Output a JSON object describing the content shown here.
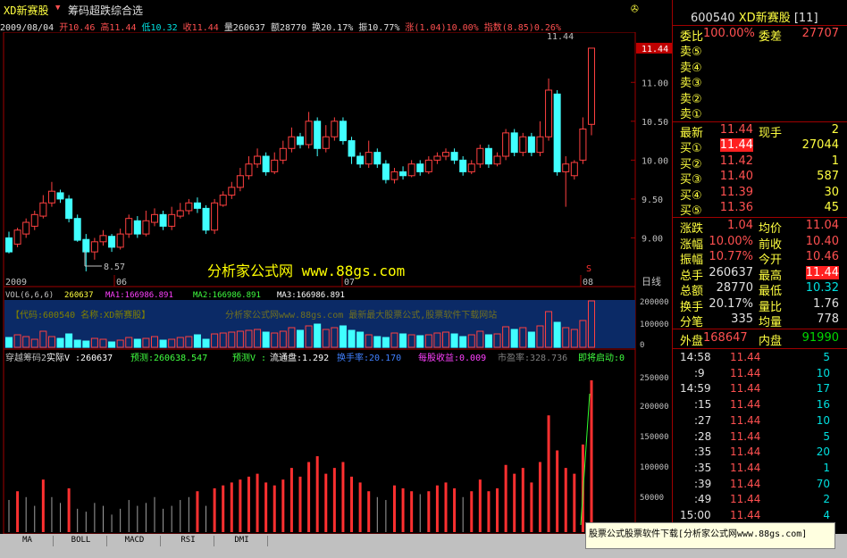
{
  "header": {
    "stock_name": "XD新赛股",
    "indicator_name": "筹码超跌综合选",
    "arrow_glyph": "▼"
  },
  "info": {
    "date": "2009/08/04",
    "open": "开10.46",
    "high": "高11.44",
    "low": "低10.32",
    "close": "收11.44",
    "vol": "量260637",
    "amt": "额28770",
    "turnover": "换20.17%",
    "amp": "振10.77%",
    "chg": "涨(1.04)10.00%",
    "index": "指数(8.85)0.26%"
  },
  "chart": {
    "yticks": [
      "11.00",
      "10.50",
      "10.00",
      "9.50",
      "9.00"
    ],
    "price_tag": "11.44",
    "high_label": "11.44",
    "low_label": "8.57",
    "x_labels": [
      "2009",
      "06",
      "07",
      "08"
    ],
    "period": "日线",
    "watermark": "分析家公式网 www.88gs.com",
    "sell_mark": "S"
  },
  "vol": {
    "title": "VOL(6,6,6)",
    "val": "260637",
    "ma1": "MA1:166986.891",
    "ma2": "MA2:166986.891",
    "ma3": "MA3:166986.891",
    "banner": "【代码:600540 名称:XD新赛股】",
    "banner2": "分析家公式网www.88gs.com 最新最大股票公式,股票软件下载网站",
    "yticks": [
      "200000",
      "100000",
      "0"
    ]
  },
  "ind": {
    "name": "穿越筹码2",
    "actual": "实际V :260637",
    "forecast1": "预测:260638.547",
    "forecast2": "预测V :",
    "circ": "流通盘:1.292",
    "turn": "换手率:20.170",
    "eps": "每股收益:0.009",
    "pe": "市盈率:328.736",
    "status": "即将启动:0",
    "yticks": [
      "250000",
      "200000",
      "150000",
      "100000",
      "50000"
    ]
  },
  "panel": {
    "code": "600540",
    "name": "XD新赛股",
    "tag": "[11]",
    "weibi_label": "委比",
    "weibi": "100.00%",
    "weicha_label": "委差",
    "weicha": "27707",
    "sells": [
      "卖⑤",
      "卖④",
      "卖③",
      "卖②",
      "卖①"
    ],
    "latest_label": "最新",
    "latest": "11.44",
    "xianshou_label": "现手",
    "xianshou": "2",
    "buys": [
      {
        "l": "买①",
        "p": "11.44",
        "v": "27044"
      },
      {
        "l": "买②",
        "p": "11.42",
        "v": "1"
      },
      {
        "l": "买③",
        "p": "11.40",
        "v": "587"
      },
      {
        "l": "买④",
        "p": "11.39",
        "v": "30"
      },
      {
        "l": "买⑤",
        "p": "11.36",
        "v": "45"
      }
    ],
    "stats": [
      {
        "l": "涨跌",
        "v": "1.04",
        "l2": "均价",
        "v2": "11.04"
      },
      {
        "l": "涨幅",
        "v": "10.00%",
        "l2": "前收",
        "v2": "10.40"
      },
      {
        "l": "振幅",
        "v": "10.77%",
        "l2": "今开",
        "v2": "10.46"
      },
      {
        "l": "总手",
        "v": "260637",
        "l2": "最高",
        "v2": "11.44"
      },
      {
        "l": "总额",
        "v": "28770",
        "l2": "最低",
        "v2": "10.32"
      },
      {
        "l": "换手",
        "v": "20.17%",
        "l2": "量比",
        "v2": "1.76"
      },
      {
        "l": "分笔",
        "v": "335",
        "l2": "均量",
        "v2": "778"
      }
    ],
    "outer_label": "外盘",
    "outer": "168647",
    "inner_label": "内盘",
    "inner": "91990",
    "ticks": [
      {
        "t": "14:58",
        "p": "11.44",
        "v": "5"
      },
      {
        "t": ":9",
        "p": "11.44",
        "v": "10"
      },
      {
        "t": "14:59",
        "p": "11.44",
        "v": "17"
      },
      {
        "t": ":15",
        "p": "11.44",
        "v": "16"
      },
      {
        "t": ":27",
        "p": "11.44",
        "v": "10"
      },
      {
        "t": ":28",
        "p": "11.44",
        "v": "5"
      },
      {
        "t": ":35",
        "p": "11.44",
        "v": "20"
      },
      {
        "t": ":35",
        "p": "11.44",
        "v": "1"
      },
      {
        "t": ":39",
        "p": "11.44",
        "v": "70"
      },
      {
        "t": ":49",
        "p": "11.44",
        "v": "2"
      },
      {
        "t": "15:00",
        "p": "11.44",
        "v": "4"
      }
    ]
  },
  "tabs": [
    "MA",
    "BOLL",
    "MACD",
    "RSI",
    "DMI"
  ],
  "ad": "股票公式股票软件下载[分析家公式网www.88gs.com]",
  "chart_data": {
    "type": "candlestick",
    "candles": [
      [
        9.0,
        8.82,
        9.08,
        8.8
      ],
      [
        8.92,
        9.1,
        9.13,
        8.88
      ],
      [
        9.05,
        9.2,
        9.25,
        9.0
      ],
      [
        9.15,
        9.3,
        9.35,
        9.1
      ],
      [
        9.28,
        9.45,
        9.55,
        9.25
      ],
      [
        9.45,
        9.6,
        9.72,
        9.4
      ],
      [
        9.58,
        9.5,
        9.62,
        9.45
      ],
      [
        9.5,
        9.25,
        9.55,
        9.2
      ],
      [
        9.25,
        8.97,
        9.3,
        8.95
      ],
      [
        8.98,
        8.82,
        9.05,
        8.57
      ],
      [
        8.82,
        8.95,
        9.0,
        8.72
      ],
      [
        8.95,
        9.03,
        9.1,
        8.9
      ],
      [
        9.02,
        8.88,
        9.05,
        8.82
      ],
      [
        8.88,
        9.05,
        9.12,
        8.85
      ],
      [
        9.05,
        9.25,
        9.3,
        9.0
      ],
      [
        9.22,
        9.05,
        9.28,
        9.0
      ],
      [
        9.05,
        9.22,
        9.35,
        9.02
      ],
      [
        9.2,
        9.3,
        9.38,
        9.15
      ],
      [
        9.3,
        9.15,
        9.35,
        9.1
      ],
      [
        9.15,
        9.3,
        9.4,
        9.1
      ],
      [
        9.28,
        9.35,
        9.45,
        9.25
      ],
      [
        9.35,
        9.45,
        9.5,
        9.3
      ],
      [
        9.45,
        9.38,
        9.52,
        9.32
      ],
      [
        9.38,
        9.1,
        9.42,
        9.05
      ],
      [
        9.1,
        9.45,
        9.5,
        9.05
      ],
      [
        9.42,
        9.55,
        9.6,
        9.4
      ],
      [
        9.55,
        9.65,
        9.72,
        9.5
      ],
      [
        9.65,
        9.8,
        9.9,
        9.6
      ],
      [
        9.8,
        9.95,
        10.05,
        9.75
      ],
      [
        9.95,
        10.05,
        10.15,
        9.9
      ],
      [
        10.05,
        9.85,
        10.1,
        9.8
      ],
      [
        9.85,
        10.0,
        10.1,
        9.82
      ],
      [
        10.0,
        10.15,
        10.25,
        9.95
      ],
      [
        10.15,
        10.3,
        10.42,
        10.1
      ],
      [
        10.3,
        10.2,
        10.35,
        10.15
      ],
      [
        10.2,
        10.5,
        10.62,
        10.15
      ],
      [
        10.5,
        10.15,
        10.55,
        10.05
      ],
      [
        10.15,
        10.3,
        10.45,
        10.1
      ],
      [
        10.3,
        10.5,
        10.55,
        10.25
      ],
      [
        10.5,
        10.25,
        10.55,
        10.2
      ],
      [
        10.25,
        10.05,
        10.3,
        9.95
      ],
      [
        10.05,
        9.95,
        10.1,
        9.9
      ],
      [
        9.95,
        10.1,
        10.25,
        9.9
      ],
      [
        10.1,
        9.95,
        10.15,
        9.9
      ],
      [
        9.95,
        9.75,
        10.0,
        9.7
      ],
      [
        9.75,
        9.85,
        9.9,
        9.7
      ],
      [
        9.85,
        9.8,
        9.92,
        9.75
      ],
      [
        9.8,
        9.95,
        10.0,
        9.78
      ],
      [
        9.95,
        9.85,
        10.0,
        9.8
      ],
      [
        9.85,
        10.0,
        10.05,
        9.82
      ],
      [
        10.0,
        10.05,
        10.1,
        9.95
      ],
      [
        10.05,
        10.1,
        10.15,
        10.0
      ],
      [
        10.1,
        10.0,
        10.15,
        9.95
      ],
      [
        10.0,
        9.85,
        10.05,
        9.8
      ],
      [
        9.85,
        9.95,
        10.0,
        9.82
      ],
      [
        9.95,
        10.15,
        10.2,
        9.9
      ],
      [
        10.15,
        9.95,
        10.2,
        9.9
      ],
      [
        9.95,
        10.05,
        10.1,
        9.92
      ],
      [
        10.05,
        10.35,
        10.4,
        10.0
      ],
      [
        10.35,
        10.1,
        10.4,
        10.05
      ],
      [
        10.1,
        10.3,
        10.35,
        10.05
      ],
      [
        10.3,
        10.1,
        10.35,
        10.05
      ],
      [
        10.1,
        10.3,
        10.5,
        10.05
      ],
      [
        10.3,
        10.9,
        11.05,
        10.25
      ],
      [
        10.85,
        9.85,
        10.9,
        9.8
      ],
      [
        9.85,
        9.95,
        10.05,
        9.4
      ],
      [
        9.8,
        9.97,
        10.0,
        9.75
      ],
      [
        10.0,
        10.4,
        10.55,
        9.95
      ],
      [
        10.46,
        11.44,
        11.44,
        10.32
      ]
    ],
    "volume_bars": [
      55,
      70,
      60,
      45,
      90,
      60,
      50,
      75,
      40,
      35,
      50,
      45,
      30,
      40,
      55,
      45,
      50,
      60,
      40,
      45,
      55,
      60,
      70,
      45,
      75,
      80,
      85,
      90,
      95,
      100,
      85,
      80,
      90,
      110,
      95,
      120,
      130,
      100,
      110,
      120,
      95,
      85,
      70,
      60,
      55,
      80,
      75,
      70,
      65,
      70,
      80,
      85,
      75,
      60,
      70,
      90,
      70,
      75,
      115,
      100,
      110,
      85,
      120,
      200,
      140,
      110,
      100,
      150,
      260
    ],
    "volume_ylim": [
      0,
      260637
    ],
    "price_ylim": [
      8.5,
      11.6
    ]
  }
}
